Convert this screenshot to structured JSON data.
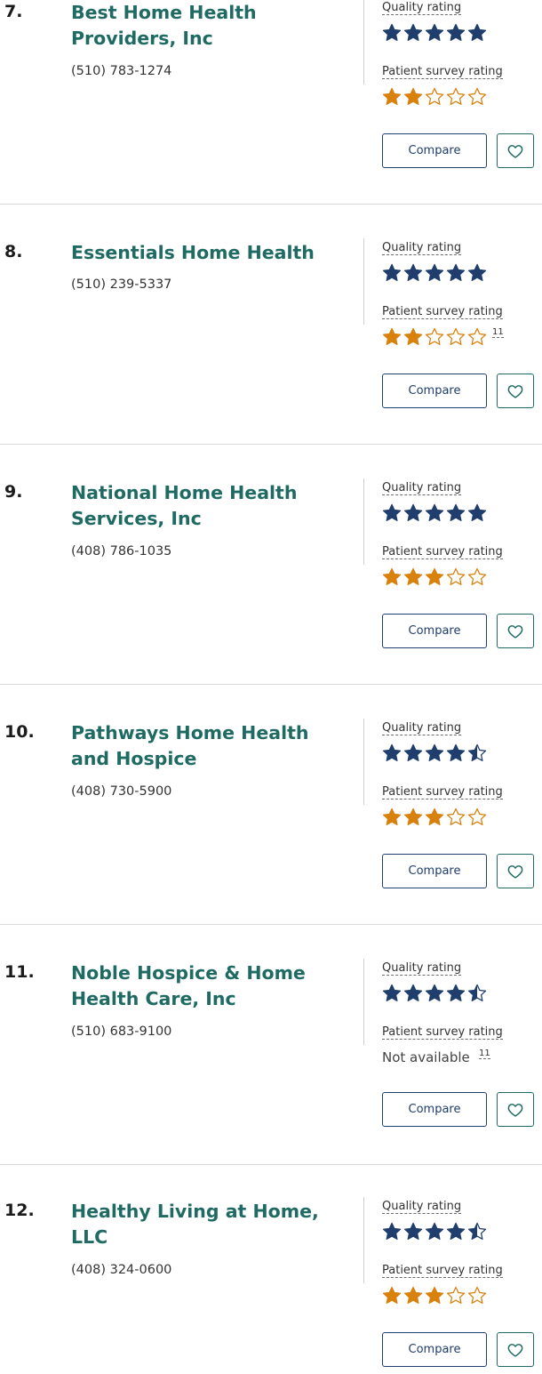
{
  "labels": {
    "quality": "Quality rating",
    "survey": "Patient survey rating",
    "compare": "Compare",
    "not_available": "Not available"
  },
  "colors": {
    "quality_star": "#1f3e6e",
    "survey_star": "#d9810d",
    "name": "#1f6b63"
  },
  "providers": [
    {
      "rank": "7.",
      "name": "Best Home Health Providers, Inc",
      "phone": "(510) 783-1274",
      "quality_rating": 5,
      "survey_rating": 2,
      "survey_footnote": ""
    },
    {
      "rank": "8.",
      "name": "Essentials Home Health",
      "phone": "(510) 239-5337",
      "quality_rating": 5,
      "survey_rating": 2,
      "survey_footnote": "11"
    },
    {
      "rank": "9.",
      "name": "National Home Health Services, Inc",
      "phone": "(408) 786-1035",
      "quality_rating": 5,
      "survey_rating": 3,
      "survey_footnote": ""
    },
    {
      "rank": "10.",
      "name": "Pathways Home Health and Hospice",
      "phone": "(408) 730-5900",
      "quality_rating": 4.5,
      "survey_rating": 3,
      "survey_footnote": ""
    },
    {
      "rank": "11.",
      "name": "Noble Hospice & Home Health Care, Inc",
      "phone": "(510) 683-9100",
      "quality_rating": 4.5,
      "survey_rating": null,
      "survey_footnote": "11"
    },
    {
      "rank": "12.",
      "name": "Healthy Living at Home, LLC",
      "phone": "(408) 324-0600",
      "quality_rating": 4.5,
      "survey_rating": 3,
      "survey_footnote": ""
    }
  ]
}
